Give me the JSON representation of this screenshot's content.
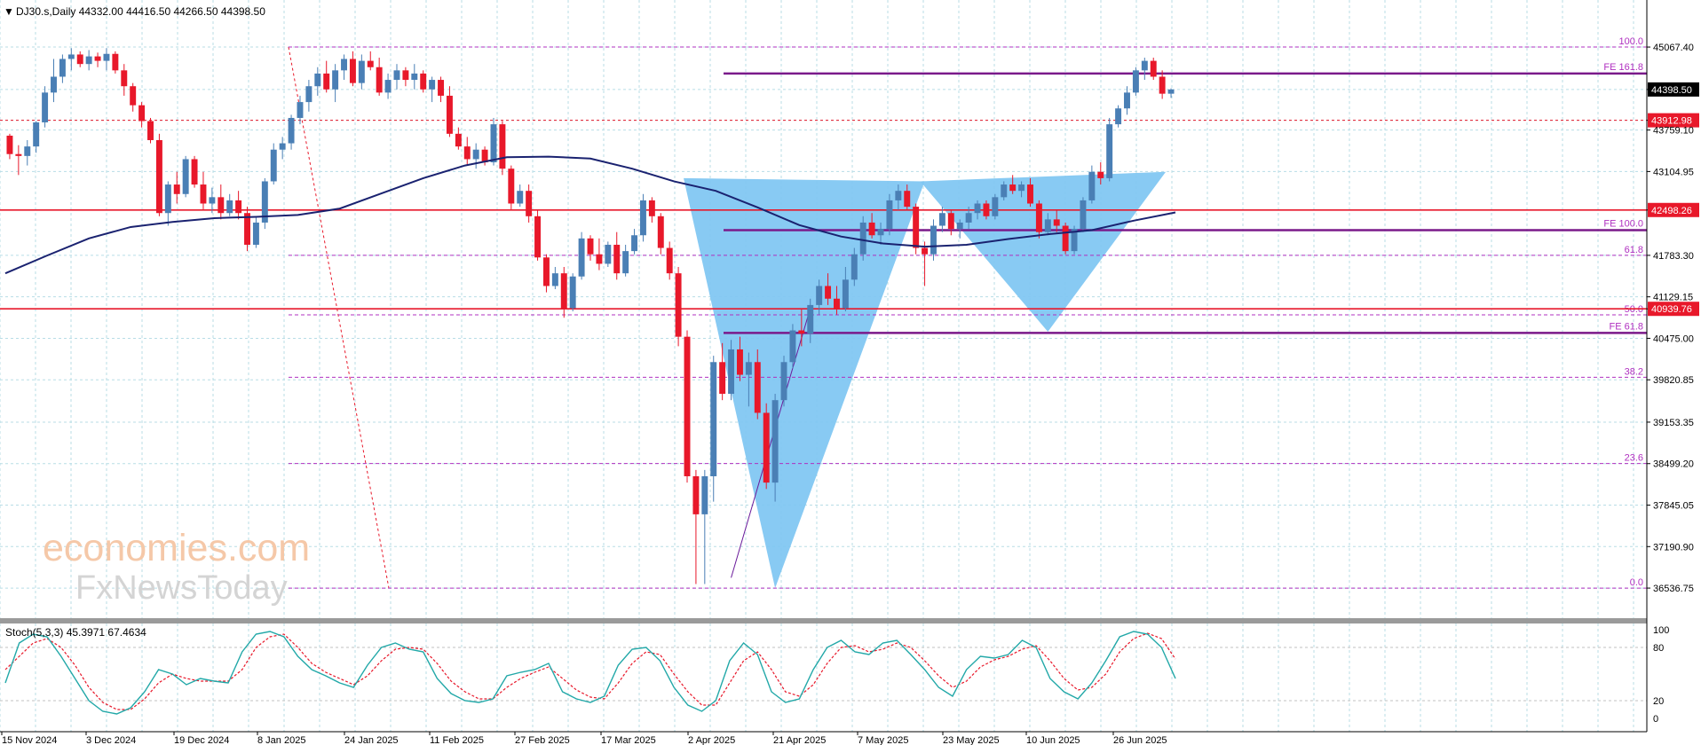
{
  "header": {
    "symbol_info": "DJ30.s,Daily  44332.00 44416.50 44266.50 44398.50"
  },
  "watermark": {
    "line1": "economies.com",
    "line2": "FxNewsToday"
  },
  "colors": {
    "bull": "#4a7fb5",
    "bear": "#e8182a",
    "ma": "#1a2270",
    "fib": "#b030c0",
    "fe": "#7a1a8a",
    "resistance": "#e8182a",
    "triangle": "#7ec6f2",
    "grid": "#b8dde6",
    "stoch_main": "#22a8a8",
    "stoch_signal": "#e8182a"
  },
  "chart_data": [
    {
      "type": "candlestick",
      "title": "DJ30.s,Daily",
      "ohlc_last": {
        "open": 44332.0,
        "high": 44416.5,
        "low": 44266.5,
        "close": 44398.5
      },
      "ylim": [
        36300,
        45250
      ],
      "y_ticks": [
        "45067.40",
        "44398.50",
        "43912.98",
        "43759.10",
        "43104.95",
        "42498.26",
        "41783.30",
        "41129.15",
        "40939.76",
        "40475.00",
        "39820.85",
        "39153.35",
        "38499.20",
        "37845.05",
        "37190.90",
        "36536.75"
      ],
      "x_labels": [
        "15 Nov 2024",
        "3 Dec 2024",
        "19 Dec 2024",
        "8 Jan 2025",
        "24 Jan 2025",
        "11 Feb 2025",
        "27 Feb 2025",
        "17 Mar 2025",
        "2 Apr 2025",
        "21 Apr 2025",
        "7 May 2025",
        "23 May 2025",
        "10 Jun 2025",
        "26 Jun 2025"
      ],
      "last_price": "44398.50",
      "levels": [
        {
          "value": 43912.98,
          "label": "43912.98",
          "style": "dotted-red"
        },
        {
          "value": 42498.26,
          "label": "42498.26",
          "style": "solid-red"
        },
        {
          "value": 40939.76,
          "label": "40939.76",
          "style": "solid-red"
        }
      ],
      "fib_levels": [
        {
          "value": 45067.4,
          "label": "100.0"
        },
        {
          "value": 41783.3,
          "label": "61.8"
        },
        {
          "value": 40845.0,
          "label": "50.0"
        },
        {
          "value": 39860.0,
          "label": "38.2"
        },
        {
          "value": 38500.0,
          "label": "23.6"
        },
        {
          "value": 36536.75,
          "label": "0.0"
        }
      ],
      "fe_levels": [
        {
          "value": 44650,
          "label": "FE 161.8"
        },
        {
          "value": 42180,
          "label": "FE 100.0"
        },
        {
          "value": 40560,
          "label": "FE 61.8"
        }
      ],
      "ma_series": [
        41500,
        41780,
        42050,
        42230,
        42310,
        42370,
        42390,
        42420,
        42520,
        42760,
        43000,
        43200,
        43330,
        43340,
        43310,
        43150,
        42950,
        42800,
        42540,
        42260,
        42080,
        41970,
        41920,
        41950,
        42040,
        42120,
        42180,
        42330,
        42460
      ],
      "candles": [
        [
          43670,
          43700,
          43300,
          43380
        ],
        [
          43380,
          43520,
          43050,
          43350
        ],
        [
          43350,
          43600,
          43200,
          43500
        ],
        [
          43500,
          43900,
          43400,
          43880
        ],
        [
          43880,
          44450,
          43800,
          44350
        ],
        [
          44350,
          44880,
          44200,
          44600
        ],
        [
          44600,
          44950,
          44500,
          44880
        ],
        [
          44880,
          45050,
          44700,
          44950
        ],
        [
          44950,
          45000,
          44750,
          44800
        ],
        [
          44800,
          45020,
          44700,
          44920
        ],
        [
          44920,
          44980,
          44750,
          44850
        ],
        [
          44850,
          45050,
          44700,
          44960
        ],
        [
          44960,
          45000,
          44650,
          44700
        ],
        [
          44700,
          44800,
          44300,
          44450
        ],
        [
          44450,
          44500,
          44050,
          44150
        ],
        [
          44150,
          44200,
          43800,
          43900
        ],
        [
          43900,
          43950,
          43550,
          43600
        ],
        [
          43600,
          43700,
          42400,
          42450
        ],
        [
          42450,
          42950,
          42250,
          42900
        ],
        [
          42900,
          43100,
          42600,
          42750
        ],
        [
          42750,
          43350,
          42700,
          43300
        ],
        [
          43300,
          43350,
          42850,
          42900
        ],
        [
          42900,
          43100,
          42500,
          42600
        ],
        [
          42600,
          42850,
          42450,
          42700
        ],
        [
          42700,
          42900,
          42350,
          42450
        ],
        [
          42450,
          42750,
          42400,
          42650
        ],
        [
          42650,
          42800,
          42350,
          42450
        ],
        [
          42450,
          42550,
          41850,
          41950
        ],
        [
          41950,
          42400,
          41900,
          42300
        ],
        [
          42300,
          43000,
          42200,
          42950
        ],
        [
          42950,
          43550,
          42900,
          43450
        ],
        [
          43450,
          43650,
          43300,
          43550
        ],
        [
          43550,
          44000,
          43450,
          43950
        ],
        [
          43950,
          44300,
          43850,
          44200
        ],
        [
          44200,
          44550,
          44050,
          44450
        ],
        [
          44450,
          44750,
          44300,
          44650
        ],
        [
          44650,
          44850,
          44350,
          44400
        ],
        [
          44400,
          44800,
          44200,
          44700
        ],
        [
          44700,
          44950,
          44550,
          44880
        ],
        [
          44880,
          45000,
          44450,
          44500
        ],
        [
          44500,
          44950,
          44400,
          44850
        ],
        [
          44850,
          45000,
          44700,
          44750
        ],
        [
          44750,
          44900,
          44300,
          44350
        ],
        [
          44350,
          44650,
          44250,
          44550
        ],
        [
          44550,
          44800,
          44400,
          44700
        ],
        [
          44700,
          44750,
          44450,
          44550
        ],
        [
          44550,
          44800,
          44400,
          44650
        ],
        [
          44650,
          44700,
          44350,
          44400
        ],
        [
          44400,
          44600,
          44200,
          44550
        ],
        [
          44550,
          44600,
          44200,
          44300
        ],
        [
          44300,
          44450,
          43650,
          43700
        ],
        [
          43700,
          43800,
          43450,
          43500
        ],
        [
          43500,
          43650,
          43200,
          43300
        ],
        [
          43300,
          43550,
          43150,
          43450
        ],
        [
          43450,
          43500,
          43200,
          43250
        ],
        [
          43250,
          43950,
          43200,
          43850
        ],
        [
          43850,
          43900,
          43050,
          43150
        ],
        [
          43150,
          43200,
          42500,
          42600
        ],
        [
          42600,
          42900,
          42550,
          42800
        ],
        [
          42800,
          42900,
          42300,
          42400
        ],
        [
          42400,
          42500,
          41700,
          41750
        ],
        [
          41750,
          41800,
          41200,
          41300
        ],
        [
          41300,
          41600,
          41250,
          41500
        ],
        [
          41500,
          41600,
          40800,
          40950
        ],
        [
          40950,
          41500,
          40900,
          41450
        ],
        [
          41450,
          42150,
          41400,
          42050
        ],
        [
          42050,
          42100,
          41700,
          41800
        ],
        [
          41800,
          42050,
          41550,
          41650
        ],
        [
          41650,
          42000,
          41600,
          41950
        ],
        [
          41950,
          42150,
          41400,
          41500
        ],
        [
          41500,
          41950,
          41450,
          41850
        ],
        [
          41850,
          42200,
          41800,
          42100
        ],
        [
          42100,
          42750,
          42000,
          42650
        ],
        [
          42650,
          42700,
          42300,
          42400
        ],
        [
          42400,
          42450,
          41800,
          41900
        ],
        [
          41900,
          42000,
          41400,
          41500
        ],
        [
          41500,
          41600,
          40350,
          40500
        ],
        [
          40500,
          40600,
          38200,
          38300
        ],
        [
          38300,
          38400,
          36600,
          37700
        ],
        [
          37700,
          38400,
          36600,
          38300
        ],
        [
          38300,
          40200,
          37900,
          40100
        ],
        [
          40100,
          40400,
          39500,
          39600
        ],
        [
          39600,
          40450,
          39500,
          40300
        ],
        [
          40300,
          40500,
          39800,
          39900
        ],
        [
          39900,
          40250,
          39400,
          40100
        ],
        [
          40100,
          40300,
          39200,
          39300
        ],
        [
          39300,
          39450,
          38100,
          38200
        ],
        [
          38200,
          39600,
          37900,
          39500
        ],
        [
          39500,
          40200,
          39400,
          40100
        ],
        [
          40100,
          40700,
          40000,
          40600
        ],
        [
          40600,
          40950,
          40350,
          40550
        ],
        [
          40550,
          41100,
          40400,
          41000
        ],
        [
          41000,
          41400,
          40850,
          41300
        ],
        [
          41300,
          41500,
          41000,
          41100
        ],
        [
          41100,
          41300,
          40850,
          40950
        ],
        [
          40950,
          41600,
          40900,
          41400
        ],
        [
          41400,
          41900,
          41300,
          41800
        ],
        [
          41800,
          42400,
          41700,
          42300
        ],
        [
          42300,
          42450,
          42050,
          42100
        ],
        [
          42100,
          42300,
          41950,
          42200
        ],
        [
          42200,
          42750,
          42100,
          42650
        ],
        [
          42650,
          42900,
          42500,
          42800
        ],
        [
          42800,
          42900,
          42500,
          42550
        ],
        [
          42550,
          42600,
          41800,
          41900
        ],
        [
          41900,
          42000,
          41300,
          41800
        ],
        [
          41800,
          42350,
          41700,
          42250
        ],
        [
          42250,
          42550,
          42150,
          42450
        ],
        [
          42450,
          42500,
          42100,
          42200
        ],
        [
          42200,
          42350,
          42050,
          42300
        ],
        [
          42300,
          42550,
          42200,
          42450
        ],
        [
          42450,
          42650,
          42350,
          42600
        ],
        [
          42600,
          42650,
          42350,
          42400
        ],
        [
          42400,
          42750,
          42350,
          42700
        ],
        [
          42700,
          42950,
          42650,
          42900
        ],
        [
          42900,
          43050,
          42750,
          42800
        ],
        [
          42800,
          42950,
          42700,
          42900
        ],
        [
          42900,
          43000,
          42550,
          42600
        ],
        [
          42600,
          42650,
          42050,
          42150
        ],
        [
          42150,
          42450,
          42100,
          42350
        ],
        [
          42350,
          42500,
          42150,
          42250
        ],
        [
          42250,
          42300,
          41800,
          41850
        ],
        [
          41850,
          42250,
          41800,
          42200
        ],
        [
          42200,
          42700,
          42150,
          42650
        ],
        [
          42650,
          43200,
          42600,
          43100
        ],
        [
          43100,
          43250,
          42900,
          43000
        ],
        [
          43000,
          43950,
          42950,
          43850
        ],
        [
          43850,
          44150,
          43800,
          44100
        ],
        [
          44100,
          44450,
          44000,
          44350
        ],
        [
          44350,
          44750,
          44300,
          44700
        ],
        [
          44700,
          44900,
          44550,
          44850
        ],
        [
          44850,
          44900,
          44550,
          44600
        ],
        [
          44600,
          44700,
          44250,
          44332
        ],
        [
          44332,
          44416.5,
          44266.5,
          44398.5
        ]
      ]
    },
    {
      "type": "line",
      "title": "Stoch(5,3,3) 45.3971 67.4634",
      "ylim": [
        0,
        100
      ],
      "y_ticks": [
        "100",
        "80",
        "20",
        "0"
      ],
      "main": [
        40,
        85,
        95,
        92,
        70,
        45,
        20,
        8,
        5,
        12,
        30,
        55,
        50,
        38,
        45,
        42,
        40,
        75,
        95,
        98,
        92,
        70,
        55,
        48,
        40,
        35,
        60,
        80,
        85,
        78,
        75,
        45,
        28,
        20,
        18,
        22,
        48,
        52,
        55,
        62,
        30,
        22,
        18,
        25,
        60,
        78,
        80,
        65,
        35,
        15,
        8,
        20,
        65,
        85,
        72,
        30,
        18,
        22,
        55,
        80,
        88,
        75,
        72,
        85,
        88,
        72,
        55,
        35,
        25,
        55,
        70,
        68,
        72,
        88,
        80,
        45,
        30,
        22,
        40,
        65,
        92,
        98,
        95,
        80,
        45
      ],
      "signal": [
        55,
        70,
        85,
        90,
        80,
        60,
        35,
        18,
        10,
        10,
        22,
        40,
        50,
        45,
        42,
        42,
        42,
        55,
        80,
        92,
        95,
        80,
        62,
        52,
        45,
        38,
        48,
        65,
        78,
        80,
        78,
        62,
        42,
        30,
        22,
        22,
        35,
        45,
        52,
        58,
        45,
        32,
        24,
        22,
        40,
        62,
        75,
        72,
        50,
        30,
        15,
        15,
        40,
        65,
        75,
        55,
        30,
        25,
        38,
        62,
        80,
        82,
        75,
        78,
        85,
        80,
        65,
        48,
        35,
        42,
        58,
        66,
        70,
        78,
        82,
        65,
        45,
        32,
        35,
        50,
        75,
        90,
        96,
        90,
        67
      ]
    }
  ]
}
